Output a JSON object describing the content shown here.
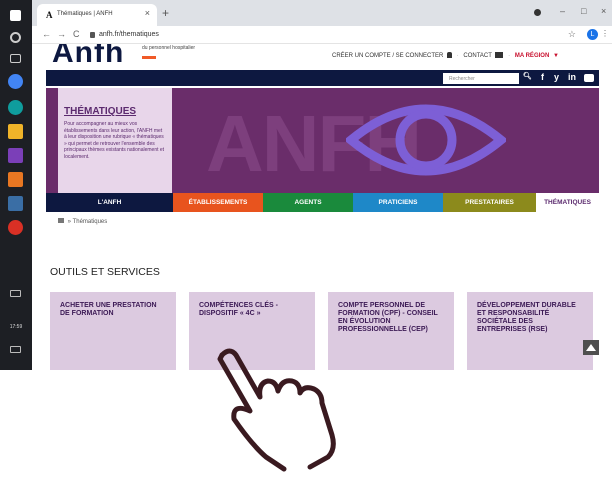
{
  "browser": {
    "tab_logo": "A",
    "tab_title": "Thématiques | ANFH",
    "tab_close": "×",
    "new_tab": "+",
    "url": "anfh.fr/thematiques",
    "profile_initial": "L",
    "window_controls": [
      "–",
      "□",
      "×"
    ]
  },
  "taskbar": {
    "time": "17:59"
  },
  "header": {
    "logo": "Anfh",
    "logo_sub": "du personnel hospitalier",
    "create_account": "CRÉER UN COMPTE / SE CONNECTER",
    "contact": "CONTACT",
    "region": "MA RÉGION"
  },
  "search": {
    "placeholder": "Rechercher"
  },
  "social": [
    "f",
    "y",
    "in"
  ],
  "hero": {
    "title": "THÉMATIQUES",
    "body": "Pour accompagner au mieux vos établissements dans leur action, l'ANFH met à leur disposition une rubrique « thématiques » qui permet de retrouver l'ensemble des principaux thèmes existants nationalement et localement."
  },
  "menu": [
    {
      "label": "L'ANFH",
      "color": "#0d1840"
    },
    {
      "label": "ÉTABLISSEMENTS",
      "color": "#e8541e"
    },
    {
      "label": "AGENTS",
      "color": "#1a8a3c"
    },
    {
      "label": "PRATICIENS",
      "color": "#1e88c8"
    },
    {
      "label": "PRESTATAIRES",
      "color": "#8c8a1c"
    },
    {
      "label": "THÉMATIQUES",
      "color": "#ffffff"
    }
  ],
  "breadcrumb": "Thématiques",
  "section_title": "OUTILS ET SERVICES",
  "tiles": [
    "ACHETER UNE PRESTATION DE FORMATION",
    "COMPÉTENCES CLÉS - DISPOSITIF « 4C »",
    "COMPTE PERSONNEL DE FORMATION (CPF) - CONSEIL EN ÉVOLUTION PROFESSIONNELLE (CEP)",
    "DÉVELOPPEMENT DURABLE ET RESPONSABILITÉ SOCIÉTALE DES ENTREPRISES (RSE)"
  ],
  "colors": {
    "navy": "#0d1840",
    "purple": "#6a2d6a",
    "tile": "#dccae0",
    "accent": "#c8102e"
  }
}
